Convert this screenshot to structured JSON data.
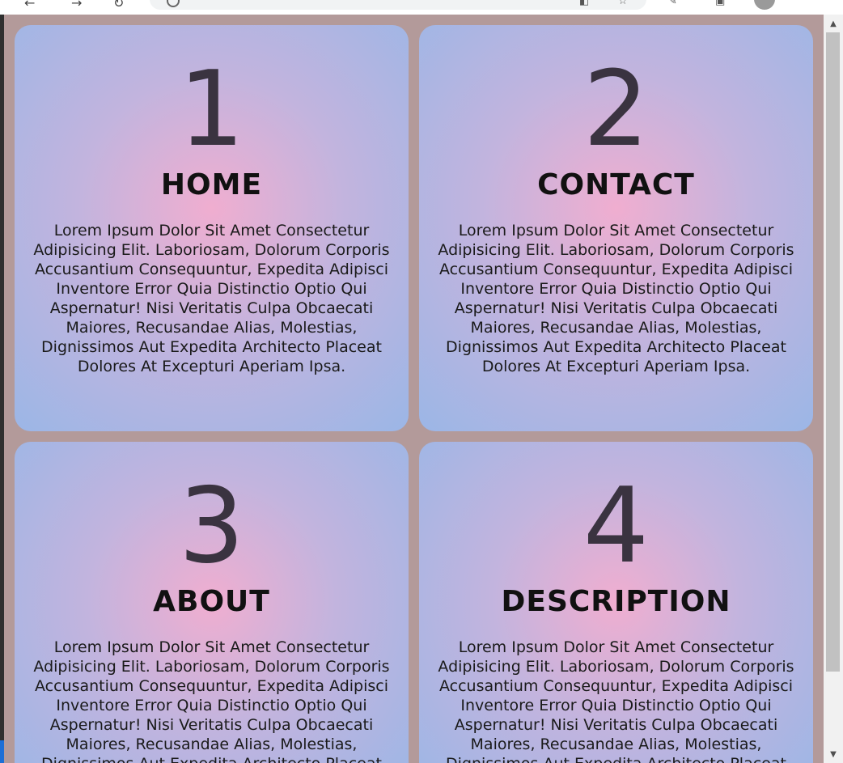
{
  "browser": {
    "back_icon": "arrow-left-icon",
    "forward_icon": "arrow-right-icon",
    "reload_icon": "reload-icon"
  },
  "cards": [
    {
      "number": "1",
      "title": "HOME",
      "text": "Lorem Ipsum Dolor Sit Amet Consectetur Adipisicing Elit. Laboriosam, Dolorum Corporis Accusantium Consequuntur, Expedita Adipisci Inventore Error Quia Distinctio Optio Qui Aspernatur! Nisi Veritatis Culpa Obcaecati Maiores, Recusandae Alias, Molestias, Dignissimos Aut Expedita Architecto Placeat Dolores At Excepturi Aperiam Ipsa."
    },
    {
      "number": "2",
      "title": "CONTACT",
      "text": "Lorem Ipsum Dolor Sit Amet Consectetur Adipisicing Elit. Laboriosam, Dolorum Corporis Accusantium Consequuntur, Expedita Adipisci Inventore Error Quia Distinctio Optio Qui Aspernatur! Nisi Veritatis Culpa Obcaecati Maiores, Recusandae Alias, Molestias, Dignissimos Aut Expedita Architecto Placeat Dolores At Excepturi Aperiam Ipsa."
    },
    {
      "number": "3",
      "title": "ABOUT",
      "text": "Lorem Ipsum Dolor Sit Amet Consectetur Adipisicing Elit. Laboriosam, Dolorum Corporis Accusantium Consequuntur, Expedita Adipisci Inventore Error Quia Distinctio Optio Qui Aspernatur! Nisi Veritatis Culpa Obcaecati Maiores, Recusandae Alias, Molestias, Dignissimos Aut Expedita Architecto Placeat Dolores At Excepturi Aperiam Ipsa."
    },
    {
      "number": "4",
      "title": "DESCRIPTION",
      "text": "Lorem Ipsum Dolor Sit Amet Consectetur Adipisicing Elit. Laboriosam, Dolorum Corporis Accusantium Consequuntur, Expedita Adipisci Inventore Error Quia Distinctio Optio Qui Aspernatur! Nisi Veritatis Culpa Obcaecati Maiores, Recusandae Alias, Molestias, Dignissimos Aut Expedita Architecto Placeat Dolores At Excepturi Aperiam Ipsa."
    }
  ],
  "colors": {
    "page_background": "#b39a9a",
    "card_center": "#f0aed0",
    "card_edge": "#9bb6e6",
    "number_color": "#3a3340",
    "title_color": "#111111"
  }
}
